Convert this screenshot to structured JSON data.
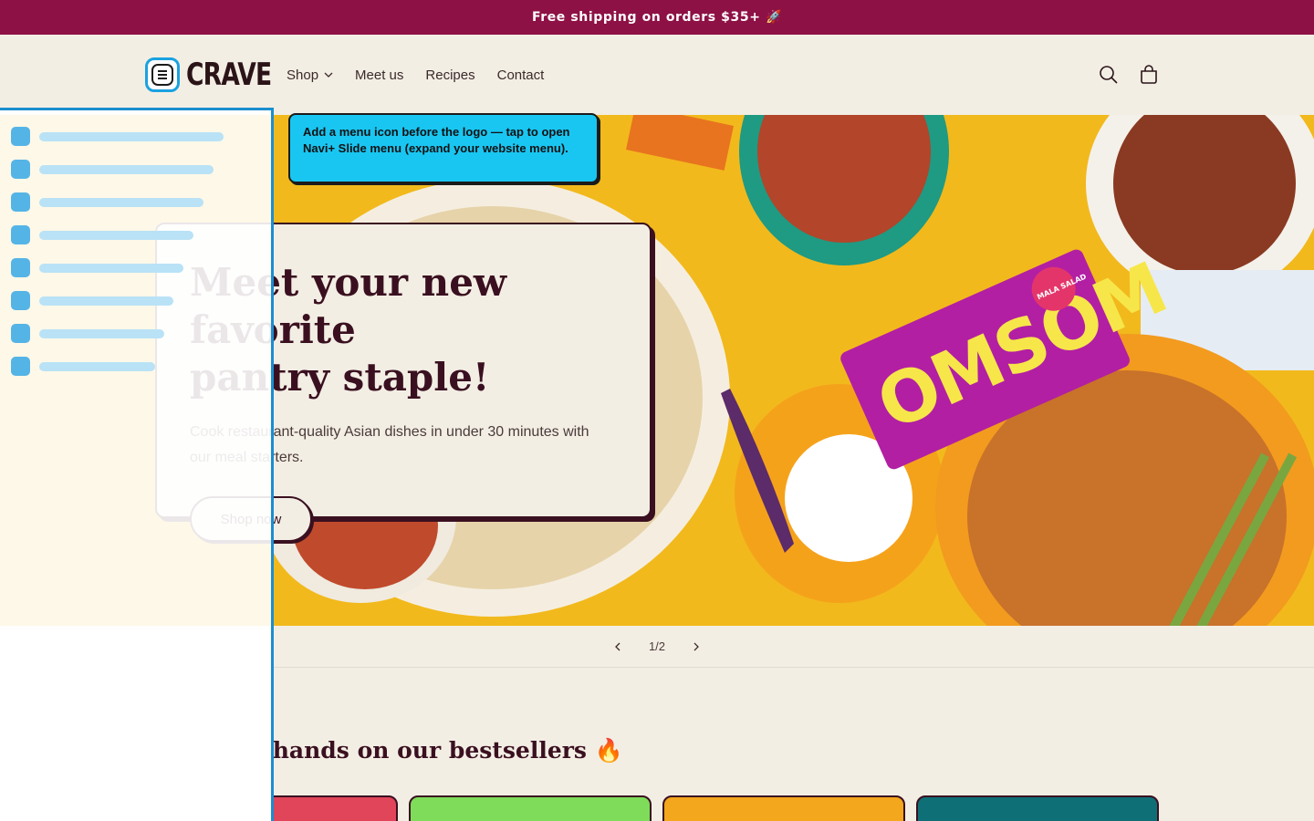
{
  "announcement": {
    "text": "Free shipping on orders $35+ 🚀"
  },
  "header": {
    "logo_text": "CRAVE",
    "nav": [
      {
        "label": "Shop",
        "has_dropdown": true
      },
      {
        "label": "Meet us"
      },
      {
        "label": "Recipes"
      },
      {
        "label": "Contact"
      }
    ],
    "icons": [
      "search-icon",
      "cart-icon",
      "hamburger-menu-icon"
    ]
  },
  "hero": {
    "title_line1": "Meet your new favorite",
    "title_line2": "pantry staple!",
    "subtitle_line1": "Cook restaurant-quality Asian dishes in under 30 minutes with",
    "subtitle_line2": "our meal starters.",
    "cta_label": "Shop now",
    "package_text": "OMSOM",
    "package_badge": "MALA SALAD"
  },
  "slider": {
    "counter": "1/2"
  },
  "tooltip": {
    "text": "Add a menu icon before the logo — tap to open Navi+ Slide menu (expand your website menu)."
  },
  "bestsellers": {
    "title": "Get your hands on our bestsellers 🔥"
  },
  "colors": {
    "announcement_bg": "#8e1145",
    "accent": "#1aa2e0",
    "tooltip_bg": "#19c6f2",
    "page_bg": "#f3eee4",
    "text": "#3a1020"
  }
}
